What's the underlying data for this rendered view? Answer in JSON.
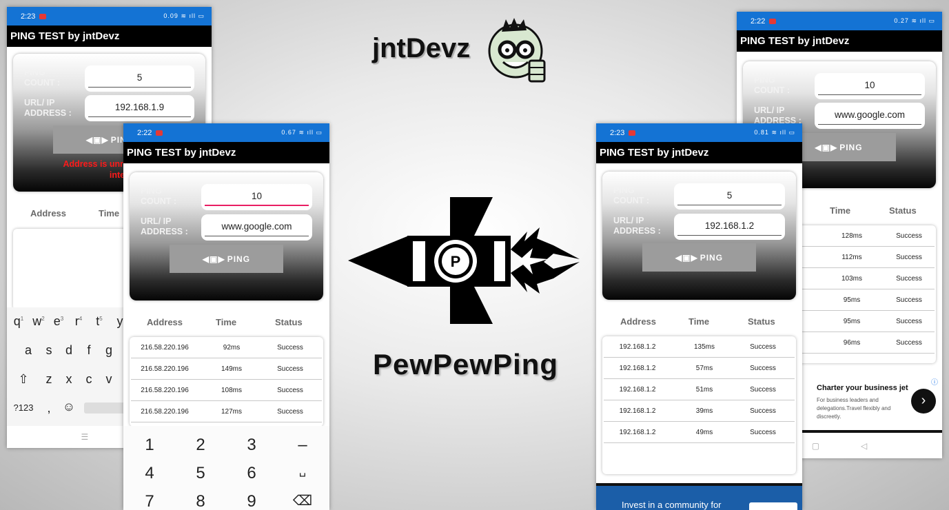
{
  "app_title": "PING TEST by jntDevz",
  "brand": "jntDevz",
  "app_name": "PewPewPing",
  "labels": {
    "ping_count_1": "PING",
    "ping_count_2": "COUNT :",
    "url_1": "URL/ IP",
    "url_2": "ADDRESS :",
    "ping_button": "PING"
  },
  "columns": {
    "address": "Address",
    "time": "Time",
    "status": "Status"
  },
  "phone1": {
    "time": "2:23",
    "net": "0.09",
    "count": "5",
    "url": "192.168.1.9",
    "error": [
      "Address is unreachabl",
      "internet conn"
    ],
    "keys_row1": [
      "q",
      "w",
      "e",
      "r",
      "t",
      "y"
    ],
    "keys_row1_num": [
      "1",
      "2",
      "3",
      "4",
      "5"
    ],
    "keys_row2": [
      "a",
      "s",
      "d",
      "f",
      "g"
    ],
    "keys_row3": [
      "⇧",
      "z",
      "x",
      "c",
      "v"
    ],
    "keys_row4": [
      "?123",
      ",",
      "☺"
    ]
  },
  "phone2": {
    "time": "2:22",
    "net": "0.67",
    "count": "10",
    "url": "www.google.com",
    "rows": [
      {
        "address": "216.58.220.196",
        "time": "92ms",
        "status": "Success"
      },
      {
        "address": "216.58.220.196",
        "time": "149ms",
        "status": "Success"
      },
      {
        "address": "216.58.220.196",
        "time": "108ms",
        "status": "Success"
      },
      {
        "address": "216.58.220.196",
        "time": "127ms",
        "status": "Success"
      }
    ],
    "numpad": [
      "1",
      "2",
      "3",
      "–",
      "4",
      "5",
      "6",
      "␣",
      "7",
      "8",
      "9",
      "⌫"
    ]
  },
  "phone3": {
    "time": "2:23",
    "net": "0.81",
    "count": "5",
    "url": "192.168.1.2",
    "rows": [
      {
        "address": "192.168.1.2",
        "time": "135ms",
        "status": "Success"
      },
      {
        "address": "192.168.1.2",
        "time": "57ms",
        "status": "Success"
      },
      {
        "address": "192.168.1.2",
        "time": "51ms",
        "status": "Success"
      },
      {
        "address": "192.168.1.2",
        "time": "39ms",
        "status": "Success"
      },
      {
        "address": "192.168.1.2",
        "time": "49ms",
        "status": "Success"
      }
    ],
    "ad_text": "Invest in a community for"
  },
  "phone4": {
    "time": "2:22",
    "net": "0.27",
    "count": "10",
    "url": "www.google.com",
    "rows": [
      {
        "time": "128ms",
        "status": "Success"
      },
      {
        "time": "112ms",
        "status": "Success"
      },
      {
        "time": "103ms",
        "status": "Success"
      },
      {
        "time": "95ms",
        "status": "Success"
      },
      {
        "time": "95ms",
        "status": "Success"
      },
      {
        "time": "96ms",
        "status": "Success"
      }
    ],
    "ad_title": "Charter your business jet",
    "ad_body": "For business leaders and delegations.Travel flexibly and discreetly."
  }
}
